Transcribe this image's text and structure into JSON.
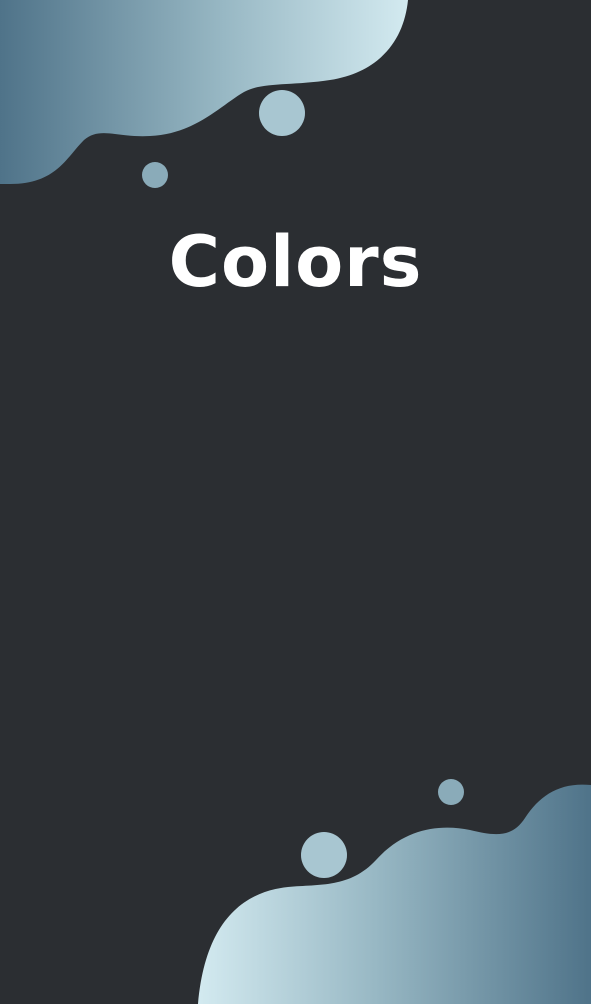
{
  "page": {
    "title": "Colors"
  },
  "colors": {
    "background": "#2b2e32",
    "blob_light": "#d3eaf0",
    "blob_mid": "#9dbfcb",
    "blob_dark": "#4f7389",
    "bubble_light": "#a8c6d1",
    "bubble_mid": "#8aabb9"
  }
}
